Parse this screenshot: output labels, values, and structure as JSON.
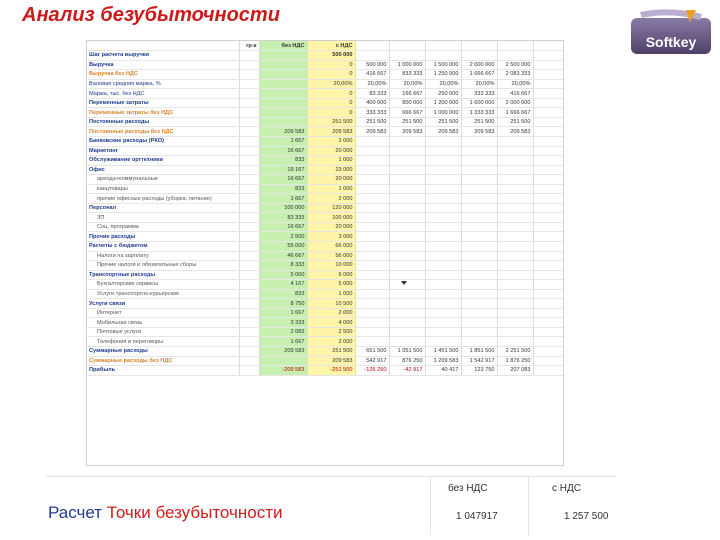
{
  "title": "Анализ безубыточности",
  "logo": {
    "text": "Softkey",
    "icon": "softkey-logo",
    "color": "#6a5a86"
  },
  "colors": {
    "title": "#cc1b1b",
    "bez_nds_column": "#c6efb0",
    "s_nds_column": "#fff5a8",
    "negative": "#c00000",
    "orange_label": "#d9822b"
  },
  "sheet": {
    "header": {
      "col0": "",
      "col1": "гр-к",
      "bez_nds": "без НДС",
      "s_nds": "с НДС"
    },
    "rows": [
      {
        "label": "Шаг расчета выручки",
        "style": "hdr",
        "v1": "",
        "v2": "500 000",
        "cols": [
          "",
          "",
          "",
          "",
          "",
          ""
        ]
      },
      {
        "label": "Выручка",
        "style": "bold",
        "v1": "",
        "v2": "0",
        "cols": [
          "500 000",
          "1 000 000",
          "1 500 000",
          "2 000 000",
          "2 500 000"
        ]
      },
      {
        "label": "Выручка без НДС",
        "style": "orange",
        "v1": "",
        "v2": "0",
        "cols": [
          "416 667",
          "833 333",
          "1 250 000",
          "1 666 667",
          "2 083 333"
        ]
      },
      {
        "label": "Валовая средняя маржа, %",
        "style": "",
        "v1": "",
        "v2": "20,00%",
        "cols": [
          "20,00%",
          "20,00%",
          "20,00%",
          "20,00%",
          "20,00%"
        ]
      },
      {
        "label": "Маржа, тыс. без НДС",
        "style": "",
        "v1": "",
        "v2": "0",
        "cols": [
          "83 333",
          "166 667",
          "250 000",
          "333 333",
          "416 667"
        ]
      },
      {
        "label": "Переменные затраты",
        "style": "bold",
        "v1": "",
        "v2": "0",
        "cols": [
          "400 000",
          "800 000",
          "1 200 000",
          "1 600 000",
          "2 000 000"
        ]
      },
      {
        "label": "Переменные затраты без НДС",
        "style": "orange",
        "v1": "",
        "v2": "0",
        "cols": [
          "333 333",
          "666 667",
          "1 000 000",
          "1 333 333",
          "1 666 667"
        ]
      },
      {
        "label": "Постоянные расходы",
        "style": "bold",
        "v1": "",
        "v2": "251 500",
        "cols": [
          "251 500",
          "251 500",
          "251 500",
          "251 500",
          "251 500"
        ]
      },
      {
        "label": "Постоянные расходы без НДС",
        "style": "orange",
        "v1": "209 583",
        "v2": "209 583",
        "cols": [
          "209 583",
          "209 583",
          "209 583",
          "209 583",
          "209 583"
        ]
      },
      {
        "label": "Банковские расходы (РКО)",
        "style": "bold",
        "v1": "1 667",
        "v2": "2 000",
        "cols": [
          "",
          "",
          "",
          "",
          ""
        ]
      },
      {
        "label": "Маркетинг",
        "style": "bold",
        "v1": "16 667",
        "v2": "20 000",
        "cols": [
          "",
          "",
          "",
          "",
          ""
        ]
      },
      {
        "label": "Обслуживание оргтехники",
        "style": "bold",
        "v1": "833",
        "v2": "1 000",
        "cols": [
          "",
          "",
          "",
          "",
          ""
        ]
      },
      {
        "label": "Офис",
        "style": "bold",
        "v1": "19 167",
        "v2": "23 000",
        "cols": [
          "",
          "",
          "",
          "",
          ""
        ]
      },
      {
        "label": "аренда+коммунальные",
        "style": "indent",
        "v1": "16 667",
        "v2": "20 000",
        "cols": [
          "",
          "",
          "",
          "",
          ""
        ]
      },
      {
        "label": "канцтовары",
        "style": "indent",
        "v1": "833",
        "v2": "1 000",
        "cols": [
          "",
          "",
          "",
          "",
          ""
        ]
      },
      {
        "label": "прочие офисные расходы (уборка, питание)",
        "style": "indent",
        "v1": "1 667",
        "v2": "2 000",
        "cols": [
          "",
          "",
          "",
          "",
          ""
        ]
      },
      {
        "label": "Персонал",
        "style": "bold",
        "v1": "100 000",
        "v2": "120 000",
        "cols": [
          "",
          "",
          "",
          "",
          ""
        ]
      },
      {
        "label": "ЗП",
        "style": "indent",
        "v1": "83 333",
        "v2": "100 000",
        "cols": [
          "",
          "",
          "",
          "",
          ""
        ]
      },
      {
        "label": "Соц. программа",
        "style": "indent",
        "v1": "16 667",
        "v2": "20 000",
        "cols": [
          "",
          "",
          "",
          "",
          ""
        ]
      },
      {
        "label": "Прочие расходы",
        "style": "bold",
        "v1": "2 500",
        "v2": "3 000",
        "cols": [
          "",
          "",
          "",
          "",
          ""
        ]
      },
      {
        "label": "Расчеты с бюджетом",
        "style": "bold",
        "v1": "55 000",
        "v2": "66 000",
        "cols": [
          "",
          "",
          "",
          "",
          ""
        ]
      },
      {
        "label": "Налоги на зарплату",
        "style": "indent",
        "v1": "46 667",
        "v2": "56 000",
        "cols": [
          "",
          "",
          "",
          "",
          ""
        ]
      },
      {
        "label": "Прочие налоги и обязательные сборы",
        "style": "indent",
        "v1": "8 333",
        "v2": "10 000",
        "cols": [
          "",
          "",
          "",
          "",
          ""
        ]
      },
      {
        "label": "Транспортные расходы",
        "style": "bold",
        "v1": "5 000",
        "v2": "6 000",
        "cols": [
          "",
          "",
          "",
          "",
          ""
        ]
      },
      {
        "label": "Бухгалтерские сервисы",
        "style": "indent",
        "v1": "4 167",
        "v2": "5 000",
        "cols": [
          "",
          "",
          "",
          "",
          ""
        ]
      },
      {
        "label": "Услуги транспортно-курьерские",
        "style": "indent",
        "v1": "833",
        "v2": "1 000",
        "cols": [
          "",
          "",
          "",
          "",
          ""
        ]
      },
      {
        "label": "Услуги связи",
        "style": "bold",
        "v1": "8 750",
        "v2": "10 500",
        "cols": [
          "",
          "",
          "",
          "",
          ""
        ]
      },
      {
        "label": "Интернет",
        "style": "indent",
        "v1": "1 667",
        "v2": "2 000",
        "cols": [
          "",
          "",
          "",
          "",
          ""
        ]
      },
      {
        "label": "Мобильная связь",
        "style": "indent",
        "v1": "3 333",
        "v2": "4 000",
        "cols": [
          "",
          "",
          "",
          "",
          ""
        ]
      },
      {
        "label": "Почтовые услуги",
        "style": "indent",
        "v1": "2 083",
        "v2": "2 500",
        "cols": [
          "",
          "",
          "",
          "",
          ""
        ]
      },
      {
        "label": "Телефония и переговоры",
        "style": "indent",
        "v1": "1 667",
        "v2": "2 000",
        "cols": [
          "",
          "",
          "",
          "",
          ""
        ]
      },
      {
        "label": "Суммарные расходы",
        "style": "bold",
        "v1": "209 583",
        "v2": "251 500",
        "cols": [
          "651 500",
          "1 051 500",
          "1 451 500",
          "1 851 500",
          "2 251 500"
        ]
      },
      {
        "label": "Суммарные расходы без НДС",
        "style": "orange",
        "v1": "",
        "v2": "209 583",
        "cols": [
          "542 917",
          "876 250",
          "1 209 583",
          "1 542 917",
          "1 876 250"
        ]
      },
      {
        "label": "Прибыль",
        "style": "bold",
        "v1": "-209 583",
        "v2": "-251 500",
        "cols": [
          "-126 250",
          "-42 917",
          "40 417",
          "123 750",
          "207 083"
        ]
      }
    ]
  },
  "summary": {
    "label_prefix": "Расчет ",
    "label_highlight": "Точки безубыточности",
    "col1_header": "без НДС",
    "col2_header": "с НДС",
    "col1_value": "1 047917",
    "col2_value": "1 257 500"
  }
}
